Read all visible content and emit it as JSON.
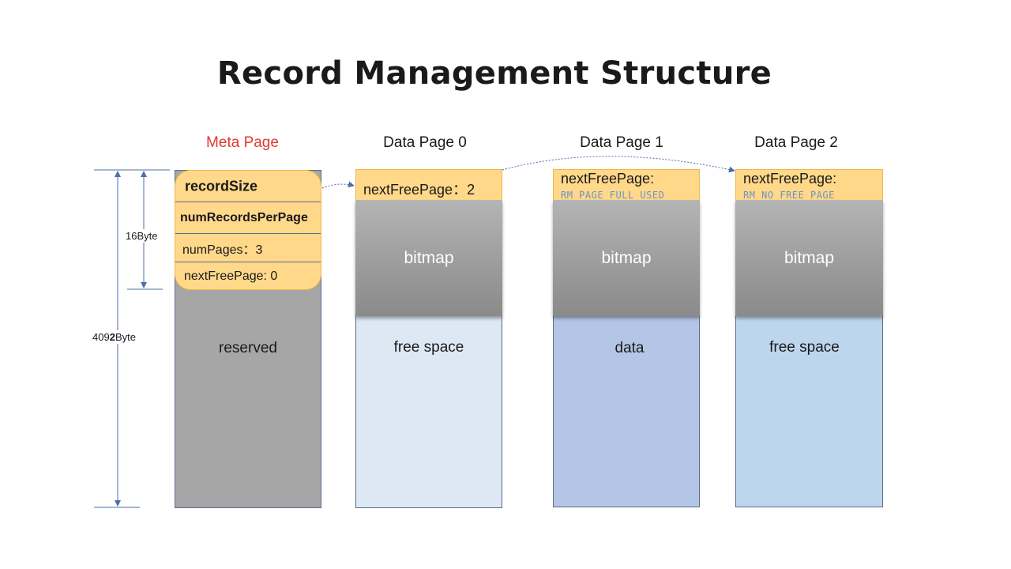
{
  "title": "Record Management Structure",
  "pages": {
    "meta": {
      "label": "Meta Page",
      "region": "reserved"
    },
    "data0": {
      "label": "Data Page 0",
      "next_free_page": "nextFreePage：2",
      "bitmap": "bitmap",
      "region": "free space"
    },
    "data1": {
      "label": "Data Page 1",
      "next_free_page": "nextFreePage:",
      "next_free_value": "RM_PAGE_FULL_USED",
      "bitmap": "bitmap",
      "region": "data"
    },
    "data2": {
      "label": "Data Page 2",
      "next_free_page": "nextFreePage:",
      "next_free_value": "RM_NO_FREE_PAGE",
      "bitmap": "bitmap",
      "region": "free space"
    }
  },
  "meta_header": {
    "record_size": "recordSize",
    "num_records_per_page": "numRecordsPerPage",
    "num_pages": "numPages：3",
    "next_free_page": "nextFreePage: 0"
  },
  "dimensions": {
    "header_size": "16Byte",
    "page_size_prefix": "409",
    "page_size_bold": "2",
    "page_size_suffix": "Byte"
  },
  "colors": {
    "meta_label": "#e03a2f",
    "header_fill": "#ffd88a",
    "meta_body": "#a6a6a6",
    "free_space": "#dde8f5",
    "data_region": "#b3c6e6",
    "free_space_2": "#bdd6ee",
    "arrow": "#4a6fa8"
  }
}
